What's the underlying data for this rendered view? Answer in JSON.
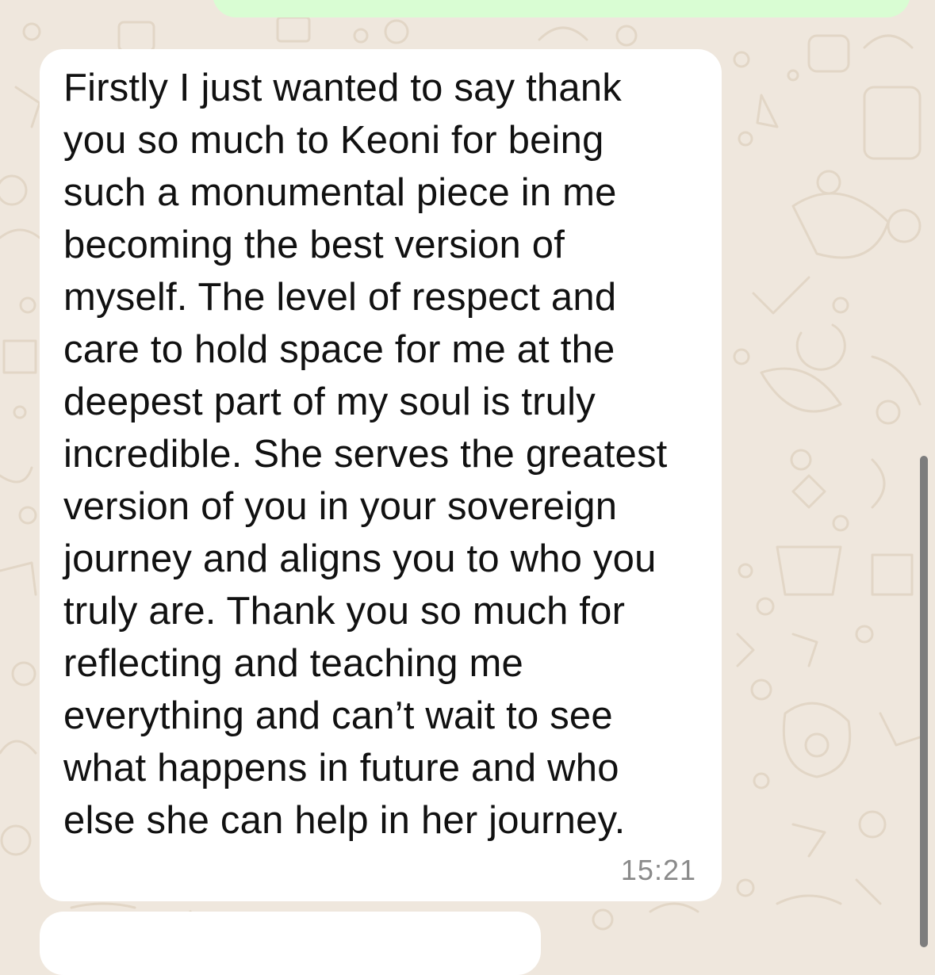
{
  "chat": {
    "background_color": "#efe7dd",
    "outgoing_bubble_color": "#d9fdd3",
    "incoming_bubble_color": "#ffffff",
    "messages": [
      {
        "direction": "incoming",
        "text": "Firstly I just wanted to say thank\nyou so much to Keoni for being\nsuch a monumental piece in me\nbecoming the best version of\nmyself. The level of respect and\ncare to hold space for me at the\ndeepest part of my soul is truly\nincredible. She serves the greatest\nversion of you in your sovereign\njourney and aligns you to who you\ntruly are. Thank you so much for\nreflecting and teaching me\neverything and can’t wait to see\nwhat happens in future and who\nelse she can help in her journey.",
        "time": "15:21"
      }
    ]
  }
}
